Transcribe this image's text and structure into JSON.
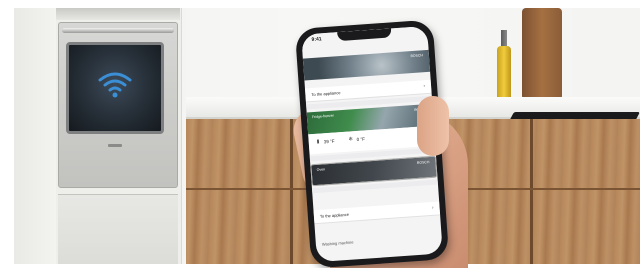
{
  "phone": {
    "status_time": "9:41",
    "header_title": "Home Connect",
    "washer_card": {
      "badge": "BOSCH"
    },
    "row1_label": "To the appliance",
    "fridge_card": {
      "name": "Fridge-freezer",
      "badge": "BOSCH"
    },
    "temp1": "39 °F",
    "temp2": "0 °F",
    "oven_card": {
      "name": "Oven",
      "badge": "BOSCH"
    },
    "row2_label": "To the appliance",
    "bottom_label": "Washing machine"
  },
  "icons": {
    "wifi": "wifi-icon",
    "fridge": "fridge-icon",
    "snowflake": "snowflake-icon",
    "chevron": "chevron-right-icon"
  },
  "colors": {
    "oven_wifi": "#3b8fd6",
    "wood": "#b58659"
  }
}
